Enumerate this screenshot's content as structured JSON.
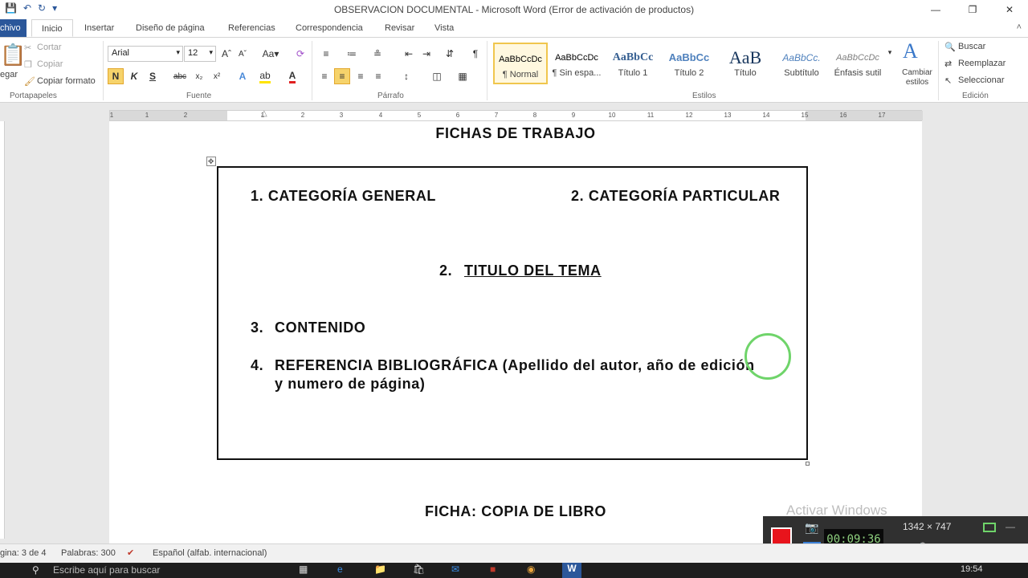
{
  "window": {
    "title": "OBSERVACION DOCUMENTAL  -  Microsoft Word (Error de activación de productos)",
    "qat_icons": [
      "save-icon",
      "undo-icon",
      "redo-icon",
      "customize-icon"
    ]
  },
  "tabs": [
    "chivo",
    "Inicio",
    "Insertar",
    "Diseño de página",
    "Referencias",
    "Correspondencia",
    "Revisar",
    "Vista"
  ],
  "ribbon": {
    "clipboard": {
      "paste": "egar",
      "cut": "Cortar",
      "copy": "Copiar",
      "format_painter": "Copiar formato",
      "label": "Portapapeles"
    },
    "font": {
      "name": "Arial",
      "size": "12",
      "label": "Fuente",
      "bold": "N",
      "italic": "K",
      "underline": "S",
      "strike": "abc"
    },
    "paragraph": {
      "label": "Párrafo"
    },
    "styles": {
      "label": "Estilos",
      "items": [
        {
          "sample": "AaBbCcDc",
          "name": "¶ Normal"
        },
        {
          "sample": "AaBbCcDc",
          "name": "¶ Sin espa..."
        },
        {
          "sample": "AaBbCc",
          "name": "Título 1"
        },
        {
          "sample": "AaBbCc",
          "name": "Título 2"
        },
        {
          "sample": "AaB",
          "name": "Título"
        },
        {
          "sample": "AaBbCc.",
          "name": "Subtítulo"
        },
        {
          "sample": "AaBbCcDc",
          "name": "Énfasis sutil"
        }
      ],
      "change": "Cambiar estilos"
    },
    "editing": {
      "label": "Edición",
      "find": "Buscar",
      "replace": "Reemplazar",
      "select": "Seleccionar"
    }
  },
  "ruler_numbers": [
    "1",
    "1",
    "2",
    "1",
    "2",
    "3",
    "4",
    "5",
    "6",
    "7",
    "8",
    "9",
    "10",
    "11",
    "12",
    "13",
    "14",
    "15",
    "16",
    "17"
  ],
  "document": {
    "heading": "FICHAS  DE TRABAJO",
    "cat_general": "1.   CATEGORÍA  GENERAL",
    "cat_particular": "2. CATEGORÍA  PARTICULAR",
    "titulo_num": "2.",
    "titulo": "TITULO  DEL TEMA",
    "contenido_num": "3.",
    "contenido": "CONTENIDO",
    "ref_num": "4.",
    "ref_line1": "REFERENCIA  BIBLIOGRÁFICA  (Apellido  del autor, año de edición",
    "ref_line2": "y numero de página)",
    "ficha": "FICHA:  COPIA DE LIBRO"
  },
  "status": {
    "page": "gina: 3 de 4",
    "words": "Palabras: 300",
    "language": "Español (alfab. internacional)"
  },
  "overlay": {
    "watermark": "Activar Windows",
    "dimensions": "1342 × 747",
    "timer": "00:09:36",
    "clock": "19:54",
    "search": "Escribe aquí para buscar"
  }
}
